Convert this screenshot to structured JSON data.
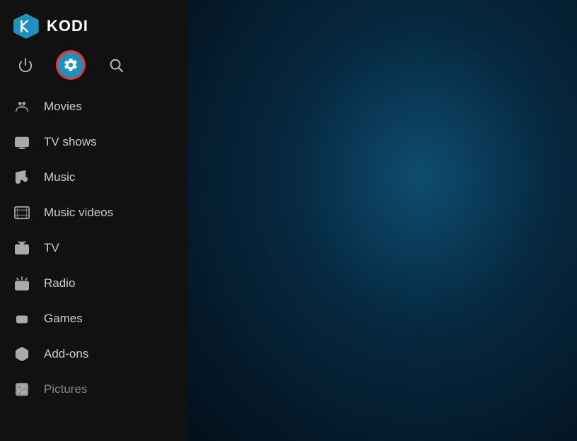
{
  "logo": {
    "text": "KODI"
  },
  "topIcons": {
    "power_label": "Power",
    "settings_label": "Settings",
    "search_label": "Search"
  },
  "nav": {
    "items": [
      {
        "id": "movies",
        "label": "Movies",
        "icon": "movies-icon"
      },
      {
        "id": "tvshows",
        "label": "TV shows",
        "icon": "tvshows-icon"
      },
      {
        "id": "music",
        "label": "Music",
        "icon": "music-icon"
      },
      {
        "id": "musicvideos",
        "label": "Music videos",
        "icon": "musicvideos-icon"
      },
      {
        "id": "tv",
        "label": "TV",
        "icon": "tv-icon"
      },
      {
        "id": "radio",
        "label": "Radio",
        "icon": "radio-icon"
      },
      {
        "id": "games",
        "label": "Games",
        "icon": "games-icon"
      },
      {
        "id": "addons",
        "label": "Add-ons",
        "icon": "addons-icon"
      },
      {
        "id": "pictures",
        "label": "Pictures",
        "icon": "pictures-icon"
      }
    ]
  }
}
